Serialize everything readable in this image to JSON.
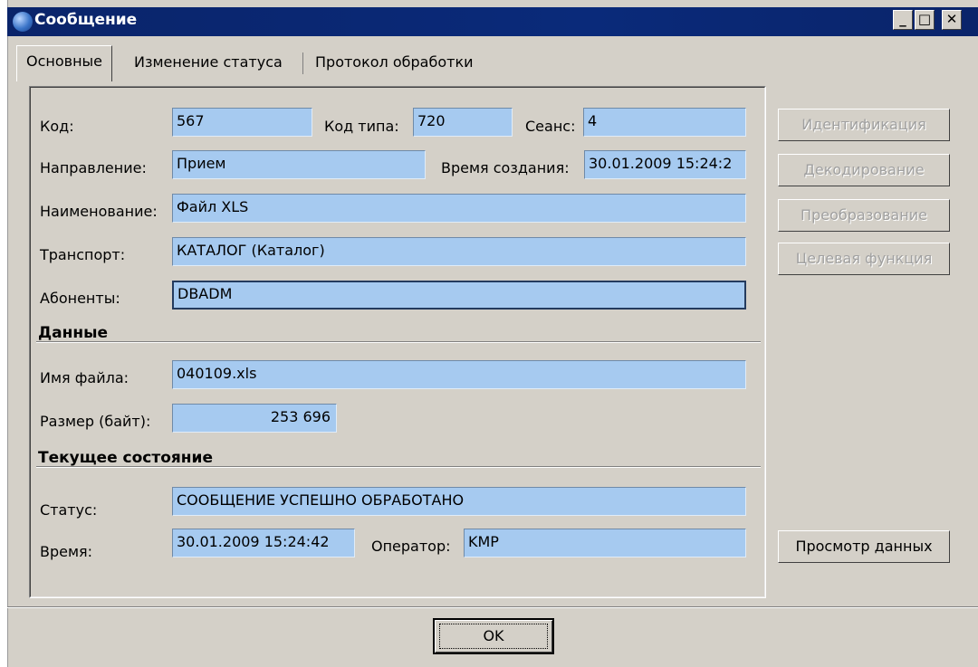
{
  "window": {
    "title": "Сообщение"
  },
  "tabs": [
    {
      "label": "Основные"
    },
    {
      "label": "Изменение статуса"
    },
    {
      "label": "Протокол обработки"
    }
  ],
  "fields": {
    "kod": {
      "label": "Код:",
      "value": "567"
    },
    "kod_tipa": {
      "label": "Код типа:",
      "value": "720"
    },
    "seans": {
      "label": "Сеанс:",
      "value": "4"
    },
    "napravlenie": {
      "label": "Направление:",
      "value": "Прием"
    },
    "vremya_sozdaniya": {
      "label": "Время создания:",
      "value": "30.01.2009 15:24:2"
    },
    "naimenovanie": {
      "label": "Наименование:",
      "value": "Файл XLS"
    },
    "transport": {
      "label": "Транспорт:",
      "value": "КАТАЛОГ (Каталог)"
    },
    "abonenty": {
      "label": "Абоненты:",
      "value": "DBADM"
    }
  },
  "data_section": {
    "title": "Данные",
    "imya_faila": {
      "label": "Имя файла:",
      "value": "040109.xls"
    },
    "razmer": {
      "label": "Размер (байт):",
      "value": "253 696"
    }
  },
  "state_section": {
    "title": "Текущее состояние",
    "status": {
      "label": "Статус:",
      "value": "СООБЩЕНИЕ УСПЕШНО ОБРАБОТАНО"
    },
    "vremya": {
      "label": "Время:",
      "value": "30.01.2009 15:24:42"
    },
    "operator": {
      "label": "Оператор:",
      "value": "KMP"
    }
  },
  "side_buttons": {
    "identifikaciya": "Идентификация",
    "dekodirovanie": "Декодирование",
    "preobrazovanie": "Преобразование",
    "celevaya": "Целевая функция",
    "prosmotr": "Просмотр данных"
  },
  "ok_label": "OK",
  "colors": {
    "field_bg": "#a6caf0",
    "titlebar": "#0a246a",
    "window_bg": "#d4d0c8"
  }
}
